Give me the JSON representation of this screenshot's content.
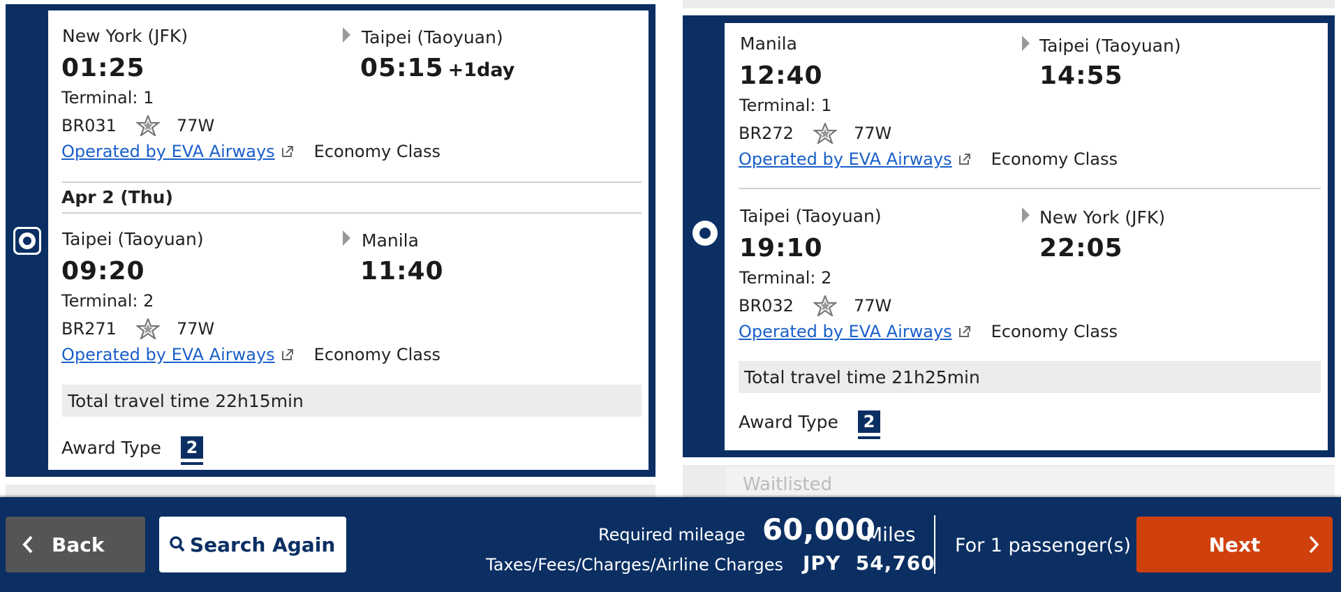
{
  "option_a": {
    "segments": [
      {
        "origin": "New York (JFK)",
        "destination": "Taipei (Taoyuan)",
        "depart_time": "01:25",
        "arrive_time": "05:15",
        "arrive_note": "+1day",
        "terminal": "Terminal: 1",
        "flight": "BR031",
        "aircraft": "77W",
        "operated_by": "Operated by EVA Airways",
        "cabin": "Economy Class"
      },
      {
        "origin": "Taipei (Taoyuan)",
        "destination": "Manila",
        "depart_time": "09:20",
        "arrive_time": "11:40",
        "terminal": "Terminal: 2",
        "flight": "BR271",
        "aircraft": "77W",
        "operated_by": "Operated by EVA Airways",
        "cabin": "Economy Class"
      }
    ],
    "date_header": "Apr 2 (Thu)",
    "total_travel_time": "Total travel time 22h15min",
    "award_type_label": "Award Type",
    "award_type_value": "2",
    "selected": true
  },
  "option_b": {
    "segments": [
      {
        "origin": "Manila",
        "destination": "Taipei (Taoyuan)",
        "depart_time": "12:40",
        "arrive_time": "14:55",
        "terminal": "Terminal: 1",
        "flight": "BR272",
        "aircraft": "77W",
        "operated_by": "Operated by EVA Airways",
        "cabin": "Economy Class"
      },
      {
        "origin": "Taipei (Taoyuan)",
        "destination": "New York (JFK)",
        "depart_time": "19:10",
        "arrive_time": "22:05",
        "terminal": "Terminal: 2",
        "flight": "BR032",
        "aircraft": "77W",
        "operated_by": "Operated by EVA Airways",
        "cabin": "Economy Class"
      }
    ],
    "total_travel_time": "Total travel time 21h25min",
    "award_type_label": "Award Type",
    "award_type_value": "2",
    "selected": true
  },
  "waitlisted_label": "Waitlisted",
  "footer": {
    "back_label": "Back",
    "search_again_label": "Search Again",
    "required_mileage_label": "Required mileage",
    "required_mileage_value": "60,000",
    "required_mileage_unit": "Miles",
    "taxes_label": "Taxes/Fees/Charges/Airline Charges",
    "taxes_value": "JPY  54,760",
    "passengers_label": "For 1 passenger(s)",
    "next_label": "Next"
  },
  "colors": {
    "navy": "#0b2f63",
    "next_orange": "#d0400c",
    "back_gray": "#555555",
    "link_blue": "#1a5fc9"
  }
}
